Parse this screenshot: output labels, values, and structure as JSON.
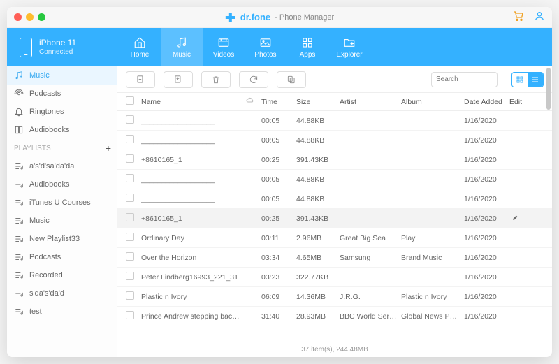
{
  "brand": {
    "name": "dr.fone",
    "subtitle": "- Phone Manager"
  },
  "device": {
    "name": "iPhone 11",
    "status": "Connected"
  },
  "nav": [
    {
      "label": "Home"
    },
    {
      "label": "Music"
    },
    {
      "label": "Videos"
    },
    {
      "label": "Photos"
    },
    {
      "label": "Apps"
    },
    {
      "label": "Explorer"
    }
  ],
  "sidebar": {
    "main": [
      {
        "label": "Music"
      },
      {
        "label": "Podcasts"
      },
      {
        "label": "Ringtones"
      },
      {
        "label": "Audiobooks"
      }
    ],
    "playlists_header": "PLAYLISTS",
    "playlists": [
      {
        "label": "a's'd'sa'da'da"
      },
      {
        "label": "Audiobooks"
      },
      {
        "label": "iTunes U Courses"
      },
      {
        "label": "Music"
      },
      {
        "label": "New Playlist33"
      },
      {
        "label": "Podcasts"
      },
      {
        "label": "Recorded"
      },
      {
        "label": "s'da's'da'd"
      },
      {
        "label": "test"
      }
    ]
  },
  "search": {
    "placeholder": "Search"
  },
  "columns": {
    "name": "Name",
    "time": "Time",
    "size": "Size",
    "artist": "Artist",
    "album": "Album",
    "date": "Date Added",
    "edit": "Edit"
  },
  "rows": [
    {
      "name": "__________________",
      "time": "00:05",
      "size": "44.88KB",
      "artist": "",
      "album": "",
      "date": "1/16/2020",
      "hi": false
    },
    {
      "name": "__________________",
      "time": "00:05",
      "size": "44.88KB",
      "artist": "",
      "album": "",
      "date": "1/16/2020",
      "hi": false
    },
    {
      "name": "+8610165_1",
      "time": "00:25",
      "size": "391.43KB",
      "artist": "",
      "album": "",
      "date": "1/16/2020",
      "hi": false
    },
    {
      "name": "__________________",
      "time": "00:05",
      "size": "44.88KB",
      "artist": "",
      "album": "",
      "date": "1/16/2020",
      "hi": false
    },
    {
      "name": "__________________",
      "time": "00:05",
      "size": "44.88KB",
      "artist": "",
      "album": "",
      "date": "1/16/2020",
      "hi": false
    },
    {
      "name": "+8610165_1",
      "time": "00:25",
      "size": "391.43KB",
      "artist": "",
      "album": "",
      "date": "1/16/2020",
      "hi": true,
      "edit": true
    },
    {
      "name": "Ordinary Day",
      "time": "03:11",
      "size": "2.96MB",
      "artist": "Great Big Sea",
      "album": "Play",
      "date": "1/16/2020",
      "hi": false
    },
    {
      "name": "Over the Horizon",
      "time": "03:34",
      "size": "4.65MB",
      "artist": "Samsung",
      "album": "Brand Music",
      "date": "1/16/2020",
      "hi": false
    },
    {
      "name": "Peter Lindberg16993_221_31",
      "time": "03:23",
      "size": "322.77KB",
      "artist": "",
      "album": "",
      "date": "1/16/2020",
      "hi": false
    },
    {
      "name": "Plastic n Ivory",
      "time": "06:09",
      "size": "14.36MB",
      "artist": "J.R.G.",
      "album": "Plastic n Ivory",
      "date": "1/16/2020",
      "hi": false
    },
    {
      "name": "Prince Andrew stepping back fro...",
      "time": "31:40",
      "size": "28.93MB",
      "artist": "BBC World Service",
      "album": "Global News Podc...",
      "date": "1/16/2020",
      "hi": false
    }
  ],
  "footer": "37 item(s), 244.48MB"
}
